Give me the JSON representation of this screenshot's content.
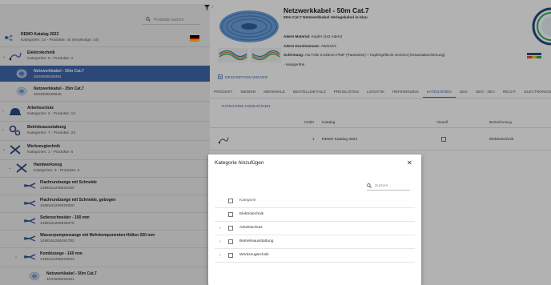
{
  "colors": {
    "accent": "#3f68ad",
    "selected_bg": "#3f68ad",
    "overlay": "rgba(0,0,0,0.30)"
  },
  "left": {
    "search_placeholder": "Produkte suchen",
    "filter_icon": "filter-icon",
    "catalog": {
      "title": "DEMO Katalog 2023",
      "subtitle": "Kategorien: 14 - Produkte: 44 (eindeutige: 44)",
      "flag": "german-flag"
    },
    "nodes": [
      {
        "t1": "Elektrotechnik",
        "t2": "Kategorien: 0 - Produkte: 2",
        "icon": "cable-icon"
      },
      {
        "t1": "Netzwerkkabel - 50m Cat.7",
        "t2": "4044506029491",
        "icon": "cable-coil-icon",
        "selected": true
      },
      {
        "t1": "Netzwerkkabel - 25m Cat.7",
        "t2": "4044506025846",
        "icon": "cable-coil-icon"
      },
      {
        "t1": "Arbeitsschutz",
        "t2": "Kategorien: 2 - Produkte: 13",
        "icon": "hardhat-icon"
      },
      {
        "t1": "Betriebsausstattung",
        "t2": "Kategorien: 7 - Produkte: 23",
        "icon": "gears-icon"
      },
      {
        "t1": "Werkzeugtechnik",
        "t2": "Kategorien: 1 - Produkte: 6",
        "icon": "tools-icon"
      },
      {
        "t1": "Handwerkzeug",
        "t2": "Kategorien: 3 - Produkte: 6",
        "icon": "tools-icon"
      },
      {
        "t1": "Flachrundzange mit Schneide",
        "t2": "1498161206529160",
        "icon": "pliers-icon"
      },
      {
        "t1": "Flachrundzange mit Schneide, gebogen",
        "t2": "1598161206529200",
        "icon": "pliers-icon"
      },
      {
        "t1": "Seitenschneider - 160 mm",
        "t2": "1498161206529379",
        "icon": "pliers-icon"
      },
      {
        "t1": "Wasserpumpenzange mit Mehrkomponenten-Hüllen 250 mm",
        "t2": "1498161206291782",
        "icon": "pliers-icon"
      },
      {
        "t1": "Kombizange - 160 mm",
        "t2": "1498161206529633",
        "icon": "pliers-icon"
      },
      {
        "t1": "Netzwerkkabel - 50m Cat.7",
        "t2": "4044506029491",
        "icon": "cable-coil-icon"
      }
    ]
  },
  "product": {
    "title": "Netzwerkkabel - 50m Cat.7",
    "subtitle": "50m Cat.7 Netzwerkkabel Verlegekabel in blau",
    "attrs": [
      {
        "k": "Adern Material:",
        "v": " Kupfer (4x2 Adern)"
      },
      {
        "k": "Adern Durchmesser:",
        "v": " AWG23/1"
      },
      {
        "k": "Schirmung:",
        "v": " Alu Folie 0,025mm PiMF (Paarweise) + Kupfergeflecht verzinnt (Gesamtabschirmung)"
      },
      {
        "k": "",
        "v": "- Halogenfrei"
      }
    ],
    "wizard": "DESCRIPTION WIZARD"
  },
  "tabs": [
    "PRODUKT",
    "MEDIEN",
    "MERKMALE",
    "BESTELLDETAILS",
    "PREISLISTEN",
    "LOGISTIK",
    "REFERENZEN",
    "KATEGORIEN",
    "UDX",
    "SEO - SEA",
    "RECHT",
    "ELECTRONICSALES"
  ],
  "active_tab": "KATEGORIEN",
  "add_category": "KATEGORIE HINZUFÜGEN",
  "table": {
    "headers": {
      "order": "Order",
      "catalog": "Katalog",
      "visual": "Visuell",
      "label": "Bezeichnung"
    },
    "rows": [
      {
        "order": "1",
        "catalog": "DEMO Katalog 2023",
        "visual": false,
        "label": "Elektrotechnik"
      }
    ]
  },
  "dialog": {
    "title": "Kategorie hinzufügen",
    "search_placeholder": "Suchen...",
    "header": "Kategorie",
    "rows": [
      {
        "label": "Elektrotechnik",
        "expandable": false
      },
      {
        "label": "Arbeitsschutz",
        "expandable": true
      },
      {
        "label": "Betriebsausstattung",
        "expandable": true
      },
      {
        "label": "Werkzeugtechnik",
        "expandable": true
      }
    ]
  }
}
